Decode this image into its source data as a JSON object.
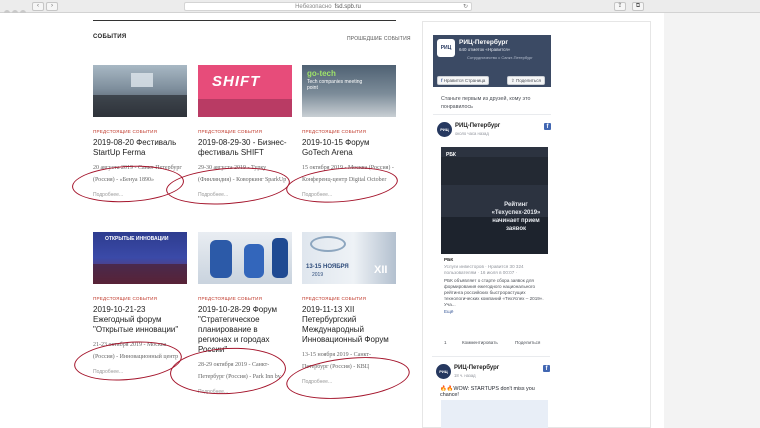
{
  "browser": {
    "security_label": "Небезопасно",
    "address": "fsd.spb.ru",
    "back_glyph": "‹",
    "forward_glyph": "›",
    "reload_glyph": "↻",
    "share_glyph": "⇪",
    "tabs_glyph": "⧉"
  },
  "section": {
    "title": "СОБЫТИЯ",
    "past_link": "ПРОШЕДШИЕ СОБЫТИЯ"
  },
  "events": [
    {
      "category": "ПРЕДСТОЯЩИЕ СОБЫТИЯ",
      "title": "2019-08-20 Фестиваль StartUp Ferma",
      "description": "20 августа 2019 - Санкт-Петербург (Россия) - «Бенуа 1890»",
      "more": "Подробнее..."
    },
    {
      "category": "ПРЕДСТОЯЩИЕ СОБЫТИЯ",
      "title": "2019-08-29-30 - Бизнес-фестиваль SHIFT",
      "description": "29-30 августа 2019 - Турку (Финляндия) - Коворкинг SparkUp",
      "more": "Подробнее...",
      "img_text": "SHIFT"
    },
    {
      "category": "ПРЕДСТОЯЩИЕ СОБЫТИЯ",
      "title": "2019-10-15 Форум GoTech Arena",
      "description": "15 октября 2019 - Москва (Россия) - Конференц-центр Digital October",
      "more": "Подробнее...",
      "img_text": "go-tech",
      "img_subtext": "Tech companies meeting point"
    },
    {
      "category": "ПРЕДСТОЯЩИЕ СОБЫТИЯ",
      "title": "2019-10-21-23 Ежегодный форум \"Открытые инновации\"",
      "description": "21-23 октября 2019 - Москва (Россия) - Инновационный центр «Сколково»",
      "more": "Подробнее...",
      "img_text": "ОТКРЫТЫЕ ИННОВАЦИИ"
    },
    {
      "category": "ПРЕДСТОЯЩИЕ СОБЫТИЯ",
      "title": "2019-10-28-29 Форум \"Стратегическое планирование в регионах и городах России\"",
      "description": "28-29 октября 2019 - Санкт-Петербург (Россия) - Park Inn by Radisson Прибалтийская",
      "more": "Подробнее..."
    },
    {
      "category": "ПРЕДСТОЯЩИЕ СОБЫТИЯ",
      "title": "2019-11-13 XII Петербургский Международный Инновационный Форум",
      "description": "13-15 ноября 2019 - Санкт-Петербург (Россия) - КВЦ \"ЭкспоФорум\"",
      "more": "Подробнее...",
      "img_text": "13-15 НОЯБРЯ",
      "img_year": "2019",
      "img_roman": "XII"
    }
  ],
  "facebook": {
    "page_name": "РИЦ-Петербург",
    "likes": "640 отметок «Нравится»",
    "page_sub": "Сотрудничество с Санкт-Петербург",
    "like_button": "Нравится Страница",
    "share_button": "Поделиться",
    "friends_text": "Станьте первым из друзей, кому это понравилось",
    "logo_text": "РИЦ",
    "fb_glyph": "f",
    "post1": {
      "name": "РИЦ-Петербург",
      "time": "около часа назад",
      "image_brand": "РБК",
      "image_headline": "Рейтинг «Техуспех-2019» начинает прием заявок",
      "source": "РБК",
      "source_line": "Услуги инвесторов · Нравится 30 324 пользователям · 16 июля в 00:07 ·",
      "body": "РБК объявляет о старте сбора заявок для формирования ежегодного национального рейтинга российских быстрорастущих технологических компаний «ТехУспех – 2019». Уча...",
      "more": "Ещё",
      "count_likes": "1",
      "comment_label": "Комментировать",
      "share_label": "Поделиться"
    },
    "post2": {
      "name": "РИЦ-Петербург",
      "time": "18 ч. назад",
      "text": "🔥🔥WOW: STARTUPS don't miss you chance!"
    }
  }
}
